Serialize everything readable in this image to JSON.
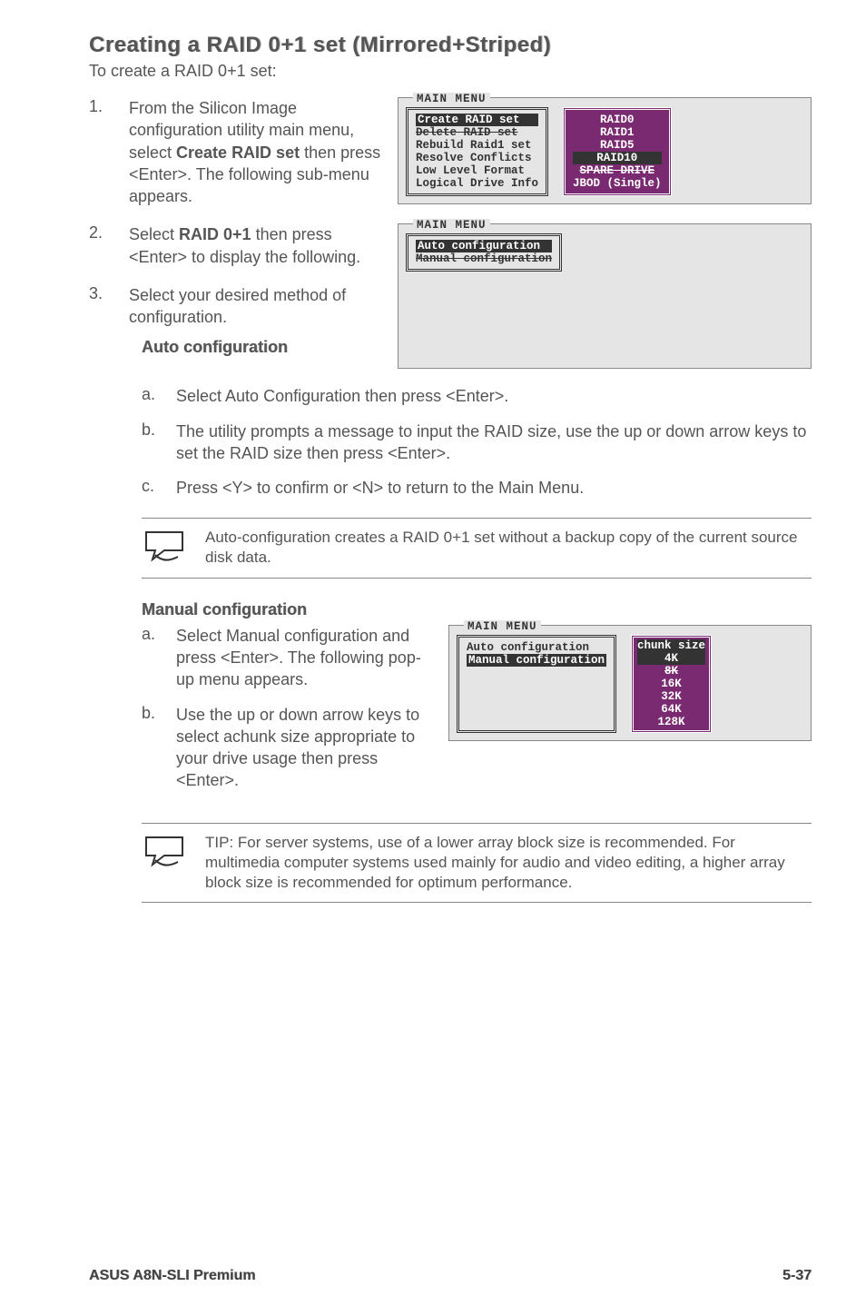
{
  "heading": "Creating a RAID 0+1 set (Mirrored+Striped)",
  "intro": "To create a RAID 0+1 set:",
  "step1": {
    "num": "1.",
    "text": "From the Silicon Image configuration utility main menu, select Create RAID set then press <Enter>. The following sub-menu appears.",
    "bold1": "Create RAID set"
  },
  "panel1": {
    "title": "MAIN MENU",
    "left": [
      "Create RAID set",
      "Delete RAID set",
      "Rebuild Raid1 set",
      "Resolve Conflicts",
      "Low Level Format",
      "Logical Drive Info"
    ],
    "right": [
      "RAID0",
      "RAID1",
      "RAID5",
      "RAID10",
      "SPARE DRIVE",
      "JBOD (Single)"
    ]
  },
  "step2": {
    "num": "2.",
    "textPre": "Select ",
    "bold": "RAID 0+1",
    "textPost": " then press <Enter> to display the following."
  },
  "step3": {
    "num": "3.",
    "text": "Select your desired method of configuration."
  },
  "panel2": {
    "title": "MAIN MENU",
    "items": [
      "Auto configuration",
      "Manual configuration"
    ]
  },
  "autoHeading": "Auto configuration",
  "autoA": {
    "letter": "a.",
    "text": "Select Auto Configuration then press <Enter>."
  },
  "autoB": {
    "letter": "b.",
    "text": "The utility prompts a message to input the RAID size, use the up or down arrow keys to set the RAID size then press <Enter>."
  },
  "autoC": {
    "letter": "c.",
    "text": "Press <Y> to confirm or <N> to return to the Main Menu."
  },
  "note1": "Auto-configuration creates a RAID 0+1 set without a backup copy of the current source disk data.",
  "manualHeading": "Manual configuration",
  "manualA": {
    "letter": "a.",
    "text": "Select  Manual configuration and press <Enter>. The following pop-up menu appears."
  },
  "manualB": {
    "letter": "b.",
    "text": "Use the up or down arrow keys to select achunk size appropriate to your drive usage then press <Enter>."
  },
  "panel3": {
    "title": "MAIN MENU",
    "left": [
      "Auto configuration",
      "Manual configuration"
    ],
    "chunkHeader": "chunk size",
    "chunks": [
      "4K",
      "8K",
      "16K",
      "32K",
      "64K",
      "128K"
    ]
  },
  "note2": "TIP: For server systems, use of a lower array block size is recommended. For multimedia computer systems used mainly for audio and video editing, a higher array block size is recommended for optimum performance.",
  "footer": {
    "left": "ASUS A8N-SLI Premium",
    "right": "5-37"
  }
}
